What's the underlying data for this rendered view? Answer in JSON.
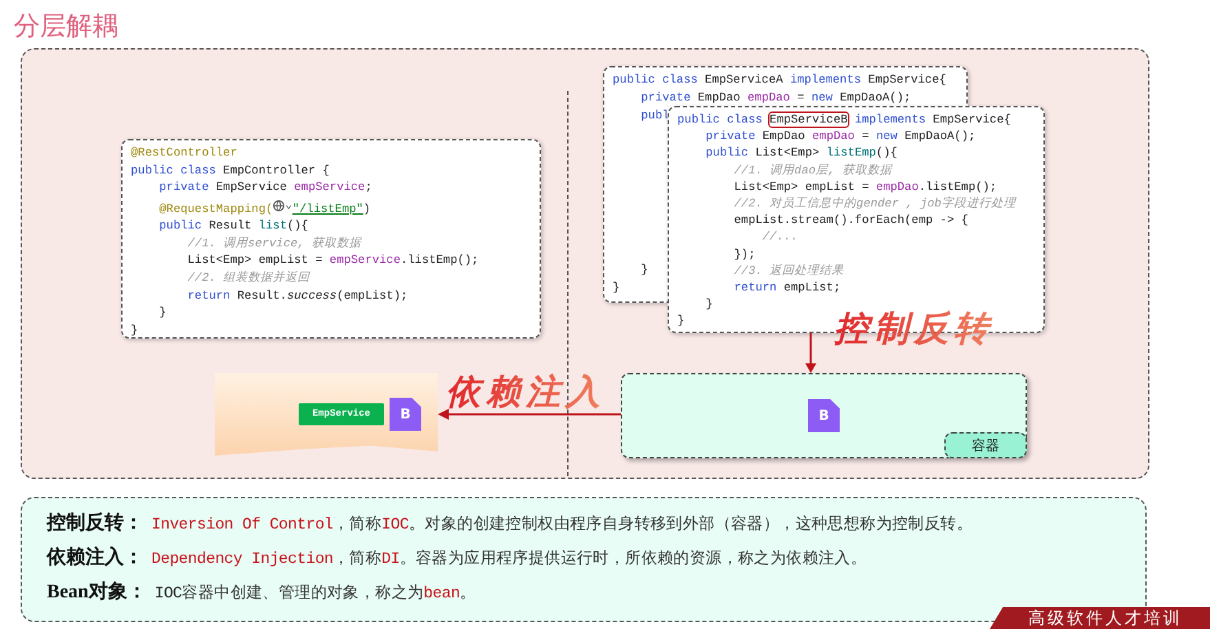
{
  "title": "分层解耦",
  "controller_code": {
    "lines": [
      [
        {
          "kind": "annotation",
          "text": "@RestController"
        }
      ],
      [
        {
          "kind": "keyword",
          "text": "public class "
        },
        {
          "kind": "plain",
          "text": "EmpController {"
        }
      ],
      [
        {
          "kind": "keyword",
          "text": "    private "
        },
        {
          "kind": "plain",
          "text": "EmpService "
        },
        {
          "kind": "field",
          "text": "empService"
        },
        {
          "kind": "plain",
          "text": ";"
        }
      ],
      [
        {
          "kind": "annotation",
          "text": "    @RequestMapping("
        },
        {
          "kind": "icon",
          "text": "⌄"
        },
        {
          "kind": "string",
          "text": "\"/listEmp\""
        },
        {
          "kind": "plain",
          "text": ")"
        }
      ],
      [
        {
          "kind": "keyword",
          "text": "    public "
        },
        {
          "kind": "plain",
          "text": "Result "
        },
        {
          "kind": "method",
          "text": "list"
        },
        {
          "kind": "plain",
          "text": "(){"
        }
      ],
      [
        {
          "kind": "comment",
          "text": "        //1. 调用service, 获取数据"
        }
      ],
      [
        {
          "kind": "plain",
          "text": "        List<Emp> empList = "
        },
        {
          "kind": "field",
          "text": "empService"
        },
        {
          "kind": "plain",
          "text": ".listEmp();"
        }
      ],
      [
        {
          "kind": "comment",
          "text": "        //2. 组装数据并返回"
        }
      ],
      [
        {
          "kind": "keyword",
          "text": "        return "
        },
        {
          "kind": "plain",
          "text": "Result."
        },
        {
          "kind": "italic",
          "text": "success"
        },
        {
          "kind": "plain",
          "text": "(empList);"
        }
      ],
      [
        {
          "kind": "plain",
          "text": "    }"
        }
      ],
      [
        {
          "kind": "plain",
          "text": "}"
        }
      ]
    ]
  },
  "service_a_code": {
    "lines_top": [
      [
        {
          "kind": "keyword",
          "text": "public class "
        },
        {
          "kind": "plain",
          "text": "EmpServiceA "
        },
        {
          "kind": "keyword",
          "text": "implements "
        },
        {
          "kind": "plain",
          "text": "EmpService{"
        }
      ],
      [
        {
          "kind": "keyword",
          "text": "    private "
        },
        {
          "kind": "plain",
          "text": "EmpDao "
        },
        {
          "kind": "field",
          "text": "empDao"
        },
        {
          "kind": "plain",
          "text": " = "
        },
        {
          "kind": "keyword",
          "text": "new "
        },
        {
          "kind": "plain",
          "text": "EmpDaoA();"
        }
      ],
      [
        {
          "kind": "keyword",
          "text": "    publ"
        }
      ]
    ],
    "lines_bottom": [
      [
        {
          "kind": "plain",
          "text": "    }"
        }
      ],
      [
        {
          "kind": "plain",
          "text": "}"
        }
      ]
    ]
  },
  "service_b_code": {
    "lines": [
      [
        {
          "kind": "keyword",
          "text": "public class "
        },
        {
          "kind": "highlight",
          "text": "EmpServiceB"
        },
        {
          "kind": "keyword",
          "text": " implements "
        },
        {
          "kind": "plain",
          "text": "EmpService{"
        }
      ],
      [
        {
          "kind": "keyword",
          "text": "    private "
        },
        {
          "kind": "plain",
          "text": "EmpDao "
        },
        {
          "kind": "field",
          "text": "empDao"
        },
        {
          "kind": "plain",
          "text": " = "
        },
        {
          "kind": "keyword",
          "text": "new "
        },
        {
          "kind": "plain",
          "text": "EmpDaoA();"
        }
      ],
      [
        {
          "kind": "keyword",
          "text": "    public "
        },
        {
          "kind": "plain",
          "text": "List<Emp> "
        },
        {
          "kind": "method",
          "text": "listEmp"
        },
        {
          "kind": "plain",
          "text": "(){"
        }
      ],
      [
        {
          "kind": "comment",
          "text": "        //1. 调用dao层, 获取数据"
        }
      ],
      [
        {
          "kind": "plain",
          "text": "        List<Emp> empList = "
        },
        {
          "kind": "field",
          "text": "empDao"
        },
        {
          "kind": "plain",
          "text": ".listEmp();"
        }
      ],
      [
        {
          "kind": "comment",
          "text": "        //2. 对员工信息中的gender , job字段进行处理"
        }
      ],
      [
        {
          "kind": "plain",
          "text": "        empList.stream().forEach(emp -> {"
        }
      ],
      [
        {
          "kind": "comment",
          "text": "            //..."
        }
      ],
      [
        {
          "kind": "plain",
          "text": "        });"
        }
      ],
      [
        {
          "kind": "comment",
          "text": "        //3. 返回处理结果"
        }
      ],
      [
        {
          "kind": "keyword",
          "text": "        return "
        },
        {
          "kind": "plain",
          "text": "empList;"
        }
      ],
      [
        {
          "kind": "plain",
          "text": "    }"
        }
      ],
      [
        {
          "kind": "plain",
          "text": "}"
        }
      ]
    ]
  },
  "ioc_label": "控制反转",
  "di_label": "依赖注入",
  "consumer": {
    "tag": "EmpService",
    "bean": "B"
  },
  "container": {
    "bean": "B",
    "label": "容器"
  },
  "definitions": [
    {
      "term": "控制反转：",
      "parts": [
        {
          "kind": "en",
          "text": "Inversion Of Control"
        },
        {
          "kind": "plain",
          "text": "，简称"
        },
        {
          "kind": "en",
          "text": "IOC"
        },
        {
          "kind": "plain",
          "text": "。对象的创建控制权由程序自身转移到外部（容器），这种思想称为控制反转。"
        }
      ]
    },
    {
      "term": "依赖注入：",
      "parts": [
        {
          "kind": "en",
          "text": "Dependency Injection"
        },
        {
          "kind": "plain",
          "text": "，简称"
        },
        {
          "kind": "en",
          "text": "DI"
        },
        {
          "kind": "plain",
          "text": "。容器为应用程序提供运行时，所依赖的资源，称之为依赖注入。"
        }
      ]
    },
    {
      "term": "Bean对象：",
      "parts": [
        {
          "kind": "code",
          "text": "IOC"
        },
        {
          "kind": "plain",
          "text": "容器中创建、管理的对象，称之为"
        },
        {
          "kind": "en",
          "text": "bean"
        },
        {
          "kind": "plain",
          "text": "。"
        }
      ]
    }
  ],
  "banner": "高级软件人才培训"
}
